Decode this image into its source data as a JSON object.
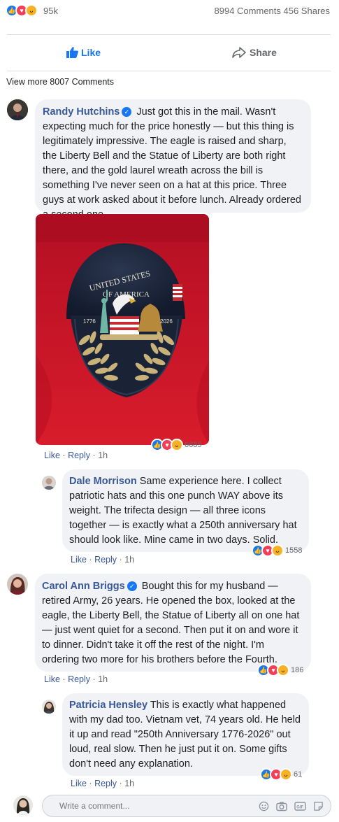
{
  "summary": {
    "reactions_count": "95k",
    "comments_shares": "8994 Comments 456 Shares"
  },
  "actions": {
    "like": "Like",
    "share": "Share"
  },
  "view_more": "View more 8007 Comments",
  "action_labels": {
    "like": "Like",
    "reply": "Reply",
    "dot": "·"
  },
  "comments": [
    {
      "author": "Randy Hutchins",
      "text": "Just got this in the mail. Wasn't expecting much for the price honestly — but this thing is legitimately impressive. The eagle is raised and sharp, the Liberty Bell and the Statue of Liberty are both right there, and the gold laurel wreath across the bill is something I've never seen on a hat at this price. Three guys at work asked about it before lunch. Already ordered a second one.",
      "reactions": "6685",
      "time": "1h",
      "photo_text": {
        "line1": "UNITED STATES",
        "line2": "OF AMERICA",
        "left_year": "1776",
        "right_year": "2026"
      },
      "replies": [
        {
          "author": "Dale Morrison",
          "text": "Same experience here. I collect patriotic hats and this one punch WAY above its weight. The trifecta design — all three icons together — is exactly what a 250th anniversary hat should look like. Mine came in two days. Solid.",
          "reactions": "1558",
          "time": "1h"
        }
      ]
    },
    {
      "author": "Carol Ann Briggs",
      "text": "Bought this for my husband — retired Army, 26 years. He opened the box, looked at the eagle, the Liberty Bell, the Statue of Liberty all on one hat — just went quiet for a second. Then put it on and wore it to dinner. Didn't take it off the rest of the night. I'm ordering two more for his brothers before the Fourth.",
      "reactions": "186",
      "time": "1h",
      "replies": [
        {
          "author": "Patricia Hensley",
          "text": "This is exactly what happened with my dad too. Vietnam vet, 74 years old. He held it up and read \"250th Anniversary 1776-2026\" out loud, real slow. Then he just put it on. Some gifts don't need any explanation.",
          "reactions": "61",
          "time": "1h"
        }
      ]
    }
  ],
  "composer": {
    "placeholder": "Write a comment..."
  },
  "colors": {
    "like_blue": "#1877f2",
    "author_blue": "#385898",
    "bubble": "#f0f2f5",
    "photo_bg": "#c8102e"
  },
  "icons": [
    "like-reaction-icon",
    "love-reaction-icon",
    "haha-reaction-icon",
    "thumbs-up-icon",
    "share-arrow-icon",
    "verified-badge-icon",
    "emoji-icon",
    "camera-icon",
    "gif-icon",
    "sticker-icon"
  ]
}
